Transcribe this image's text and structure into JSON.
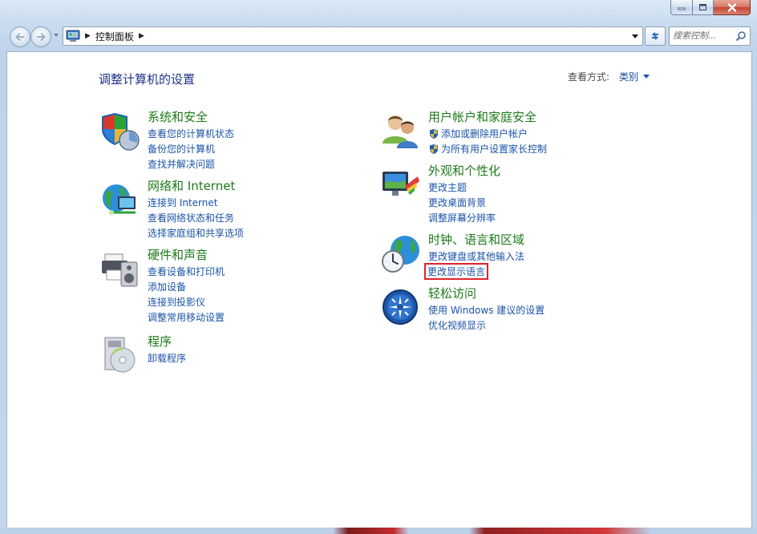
{
  "window": {
    "minimize_label": "minimize",
    "maximize_label": "maximize",
    "close_label": "close"
  },
  "address_bar": {
    "crumbs": [
      "控制面板"
    ]
  },
  "search": {
    "placeholder": "搜索控制..."
  },
  "main": {
    "title": "调整计算机的设置",
    "view_by_label": "查看方式:",
    "view_by_value": "类别"
  },
  "categories": [
    {
      "title": "系统和安全",
      "icon": "shield-chart-icon",
      "links": [
        "查看您的计算机状态",
        "备份您的计算机",
        "查找并解决问题"
      ]
    },
    {
      "title": "网络和 Internet",
      "icon": "globe-network-icon",
      "links": [
        "连接到 Internet",
        "查看网络状态和任务",
        "选择家庭组和共享选项"
      ]
    },
    {
      "title": "硬件和声音",
      "icon": "printer-speaker-icon",
      "links": [
        "查看设备和打印机",
        "添加设备",
        "连接到投影仪",
        "调整常用移动设置"
      ]
    },
    {
      "title": "程序",
      "icon": "programs-disc-icon",
      "links": [
        "卸载程序"
      ]
    },
    {
      "title": "用户帐户和家庭安全",
      "icon": "users-icon",
      "links": [
        "添加或删除用户帐户",
        "为所有用户设置家长控制"
      ]
    },
    {
      "title": "外观和个性化",
      "icon": "monitor-paint-icon",
      "links": [
        "更改主题",
        "更改桌面背景",
        "调整屏幕分辨率"
      ]
    },
    {
      "title": "时钟、语言和区域",
      "icon": "globe-clock-icon",
      "links": [
        "更改键盘或其他输入法",
        "更改显示语言"
      ]
    },
    {
      "title": "轻松访问",
      "icon": "ease-of-access-icon",
      "links": [
        "使用 Windows 建议的设置",
        "优化视频显示"
      ]
    }
  ],
  "colors": {
    "category_title": "#1c7a19",
    "link": "#1a53a8",
    "page_title": "#1e3287",
    "highlight_box": "#e0232b"
  }
}
